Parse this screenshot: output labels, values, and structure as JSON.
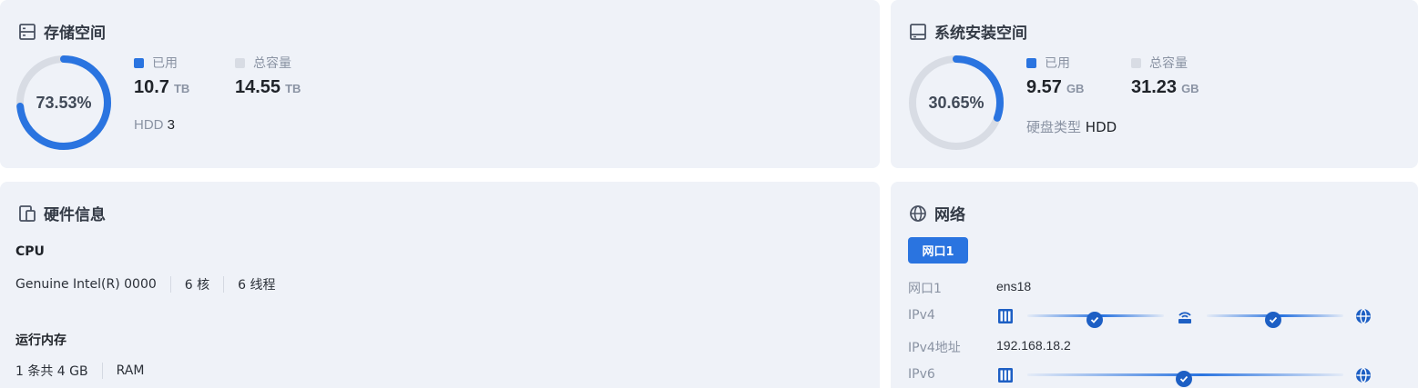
{
  "storage": {
    "title": "存储空间",
    "percent_label": "73.53%",
    "percent": 73.53,
    "used_label": "已用",
    "used_value": "10.7",
    "used_unit": "TB",
    "total_label": "总容量",
    "total_value": "14.55",
    "total_unit": "TB",
    "disk_label": "HDD",
    "disk_count": "3"
  },
  "system": {
    "title": "系统安装空间",
    "percent_label": "30.65%",
    "percent": 30.65,
    "used_label": "已用",
    "used_value": "9.57",
    "used_unit": "GB",
    "total_label": "总容量",
    "total_value": "31.23",
    "total_unit": "GB",
    "disk_type_label": "硬盘类型",
    "disk_type_value": "HDD"
  },
  "hardware": {
    "title": "硬件信息",
    "cpu_heading": "CPU",
    "cpu_model": "Genuine Intel(R) 0000",
    "cpu_cores": "6 核",
    "cpu_threads": "6 线程",
    "ram_heading": "运行内存",
    "ram_count": "1 条共 4 GB",
    "ram_type": "RAM"
  },
  "network": {
    "title": "网络",
    "tab_label": "网口1",
    "rows": [
      {
        "label": "网口1",
        "value": "ens18"
      },
      {
        "label": "IPv4",
        "value": ""
      },
      {
        "label": "IPv4地址",
        "value": "192.168.18.2"
      },
      {
        "label": "IPv6",
        "value": ""
      }
    ]
  },
  "colors": {
    "accent": "#2a74e0",
    "ring_track": "#d8dce4",
    "card_bg": "#eff2f8"
  },
  "icons": {
    "storage": "storage-icon",
    "system": "disk-icon",
    "hardware": "device-icon",
    "network": "globe-icon",
    "server": "server-icon",
    "router": "router-icon",
    "check": "check-icon"
  }
}
